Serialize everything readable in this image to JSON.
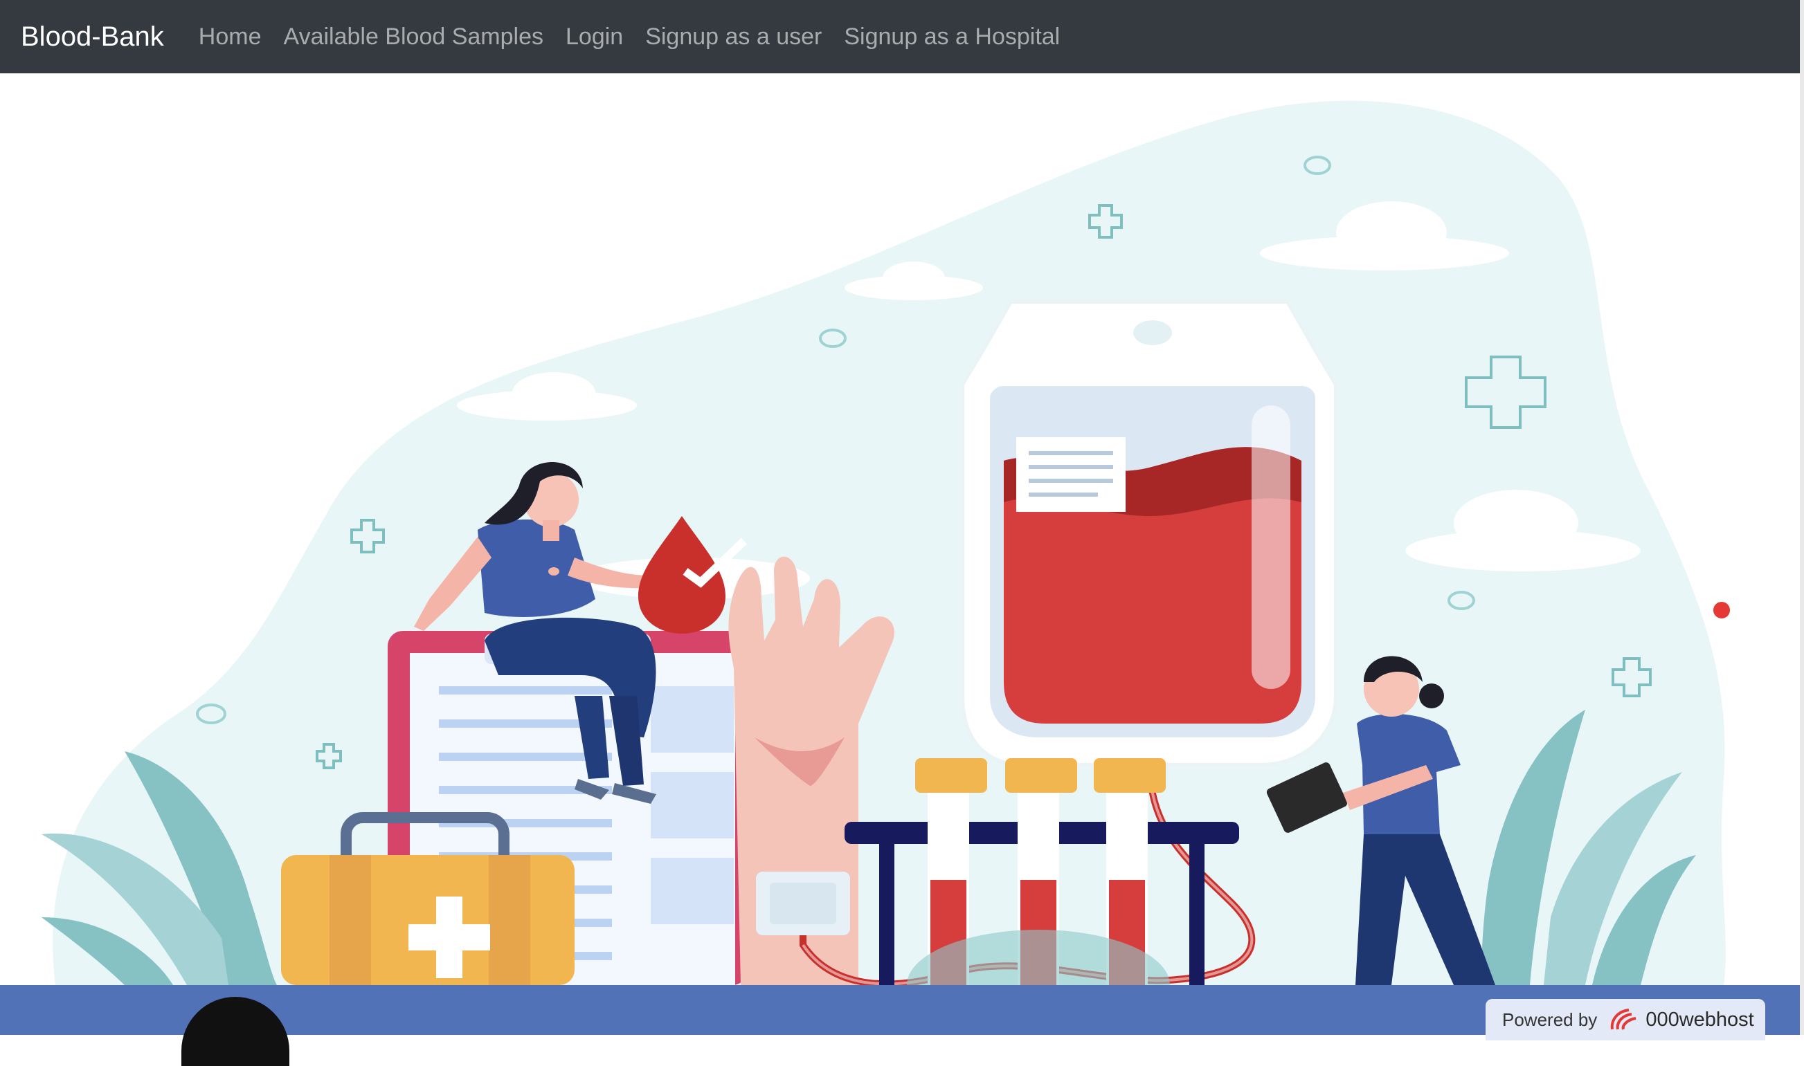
{
  "navbar": {
    "brand": "Blood-Bank",
    "links": [
      "Home",
      "Available Blood Samples",
      "Login",
      "Signup as a user",
      "Signup as a Hospital"
    ]
  },
  "footer": {
    "powered_label": "Powered by",
    "host_name": "000webhost"
  },
  "colors": {
    "navbar_bg": "#343a40",
    "footer_bg": "#5272b8",
    "accent_red": "#d83f3f"
  }
}
